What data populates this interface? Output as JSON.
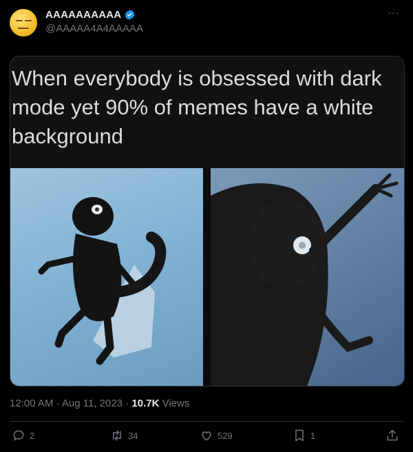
{
  "author": {
    "display_name": "AAAAAAAAAA",
    "handle": "@AAAAA4A4AAAAA",
    "verified": true,
    "avatar_icon": "smiling-face-icon"
  },
  "more_icon": "more-dots-icon",
  "media": {
    "caption": "When everybody is obsessed with dark mode yet 90% of memes have a white background",
    "images": [
      "monkey-photo-standing",
      "monkey-photo-closeup"
    ]
  },
  "meta": {
    "time": "12:00 AM",
    "separator": " · ",
    "date": "Aug 11, 2023",
    "views_count": "10.7K",
    "views_label": " Views"
  },
  "actions": {
    "reply": {
      "count": "2",
      "icon": "reply-icon"
    },
    "retweet": {
      "count": "34",
      "icon": "retweet-icon"
    },
    "like": {
      "count": "529",
      "icon": "heart-icon"
    },
    "bookmark": {
      "count": "1",
      "icon": "bookmark-icon"
    },
    "share": {
      "icon": "share-icon"
    }
  },
  "colors": {
    "verified": "#1d9bf0",
    "muted": "#71767b",
    "text": "#e7e9ea",
    "border": "#2f3336"
  }
}
